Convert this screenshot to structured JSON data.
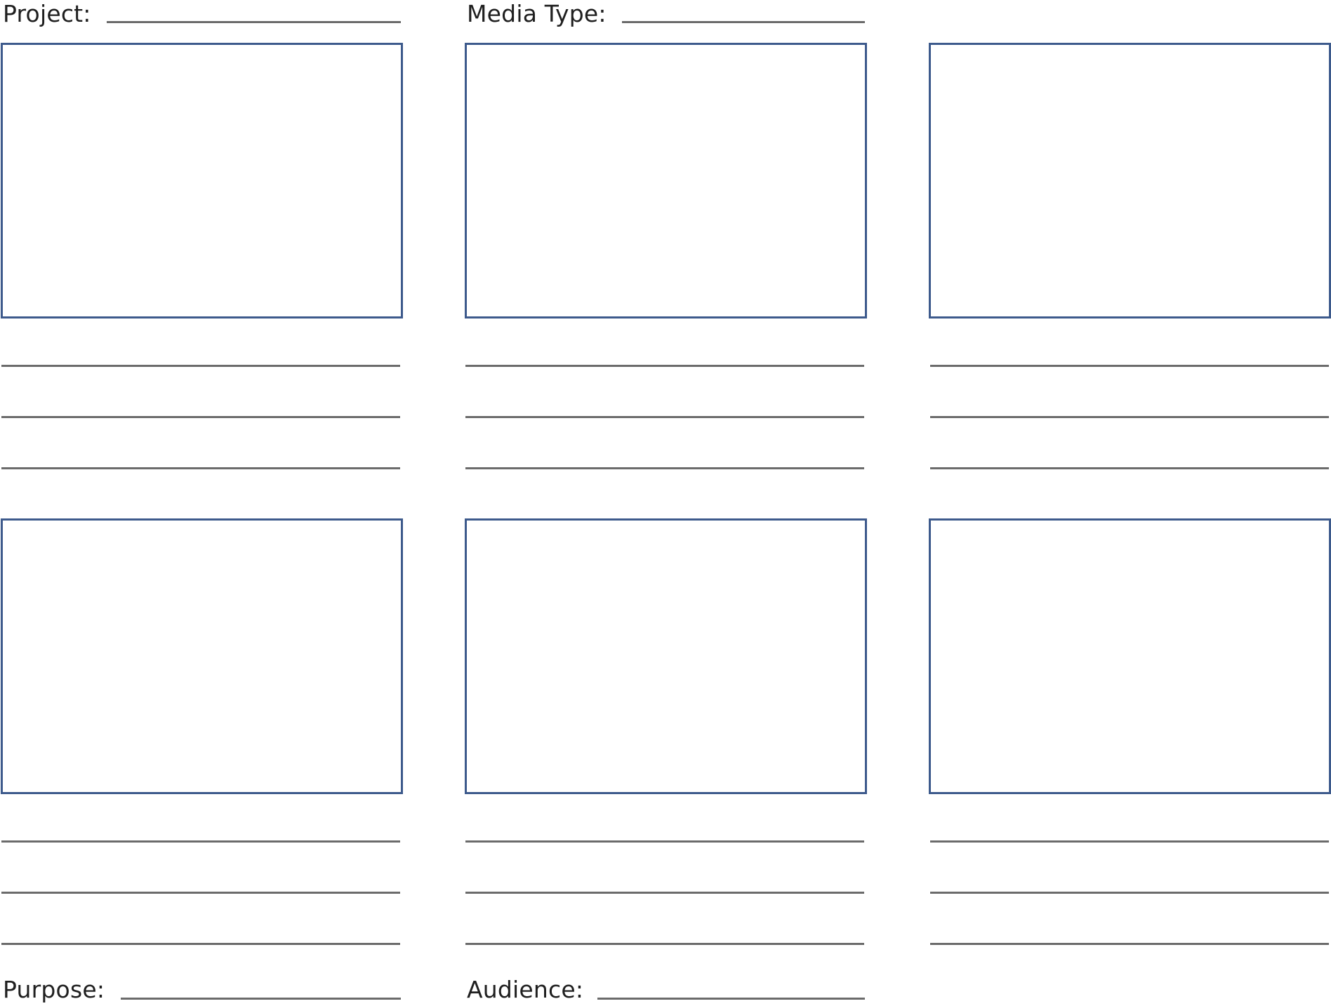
{
  "header": {
    "project_label": "Project:",
    "media_type_label": "Media Type:"
  },
  "footer": {
    "purpose_label": "Purpose:",
    "audience_label": "Audience:"
  },
  "colors": {
    "frame_border": "#3d5a8c",
    "rule_line": "#6b6b6b",
    "text": "#1f1f1f"
  },
  "storyboard": {
    "rows": 2,
    "columns": 3,
    "note_lines_per_frame": 3
  }
}
